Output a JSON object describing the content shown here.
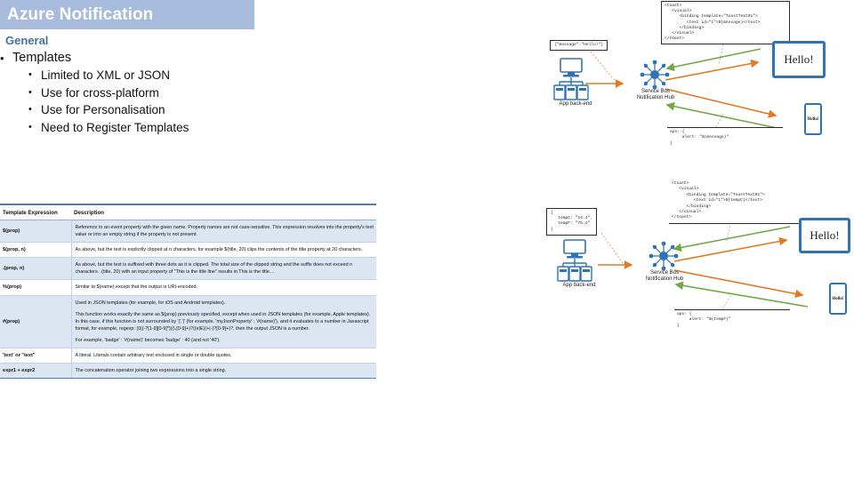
{
  "slide": {
    "title": "Azure Notification",
    "section_heading": "General"
  },
  "bullets": {
    "level1": "Templates",
    "level2": [
      "Limited to XML or JSON",
      "Use for cross-platform",
      "Use for Personalisation",
      "Need to Register Templates"
    ]
  },
  "table": {
    "headers": [
      "Template Expression",
      "Description"
    ],
    "rows": [
      {
        "expression": "$(prop)",
        "description": [
          "Reference to an event property with the given name. Property names are not case-sensitive. This expression resolves into the property's text value or into an empty string if the property is not present."
        ]
      },
      {
        "expression": "$(prop, n)",
        "description": [
          "As above, but the text is explicitly clipped at n characters, for example $(title, 20) clips the contents of the title property at 20 characters."
        ]
      },
      {
        "expression": ".(prop, n)",
        "description": [
          "As above, but the text is suffixed with three dots as it is clipped. The total size of the clipped string and the suffix does not exceed n characters. .(title, 20) with an input property of \"This is the title line\" results in This is the title…"
        ]
      },
      {
        "expression": "%(prop)",
        "description": [
          "Similar to $(name) except that the output is URI-encoded."
        ]
      },
      {
        "expression": "#(prop)",
        "description": [
          "Used in JSON templates (for example, for iOS and Android templates).",
          "This function works exactly the same as $(prop) previously specified, except when used in JSON templates (for example, Apple templates). In this case, if this function is not surrounded by '|','|' (for example, 'myJsonProperty' : '#(name)'), and it evaluates to a number in Javascript format, for example, regexp: (0|(-?[1-9][0-9]*))(\\.[0-9]+)?((e|E)(+|-)?[0-9]+)?, then the output JSON is a number.",
          "For example, 'badge' : '#(name)' becomes 'badge' : 40 (and not '40')."
        ]
      },
      {
        "expression": "'text' or \"text\"",
        "description": [
          "A literal. Literals contain arbitrary text enclosed in single or double quotes."
        ]
      },
      {
        "expression": "expr1 + expr2",
        "description": [
          "The concatenation operator joining two expressions into a single string."
        ]
      }
    ]
  },
  "diagram_top": {
    "backend_label": "App back-end",
    "hub_label": "Service Bus\nNotification Hub",
    "payload": "{\"message\":\"Hello!\"}",
    "wns_template": "<toast>\n   <visual>\n      <binding template=\"ToastText01\">\n         <text id=\"1\">$(message)</text>\n      </binding>\n   </visual>\n</toast>",
    "apns_template": "aps: {\n     alert: \"$(message)\"\n}",
    "tablet_text": "Hello!",
    "phone_text": "Hello!"
  },
  "diagram_bottom": {
    "backend_label": "App back-end",
    "hub_label": "Service Bus\nNotification Hub",
    "payload": "{\n   tempC: \"24.4\",\n   tempF: \"75.2\"\n}",
    "wns_template": "<toast>\n   <visual>\n      <binding template=\"ToastText01\">\n         <text id=\"1\">$(tempC)</text>\n      </binding>\n   </visual>\n</toast>",
    "apns_template": "aps: {\n     alert: \"$(tempF)\"\n}",
    "tablet_text": "Hello!",
    "phone_text": "Hello!"
  },
  "colors": {
    "title_bar": "#A7BBDD",
    "section_heading": "#4472A8",
    "table_header_rule": "#4A7EBB",
    "table_alt_row": "#DCE6F2",
    "device_blue": "#2E74B5",
    "arrow_green": "#70A845",
    "arrow_orange": "#E07B24"
  }
}
